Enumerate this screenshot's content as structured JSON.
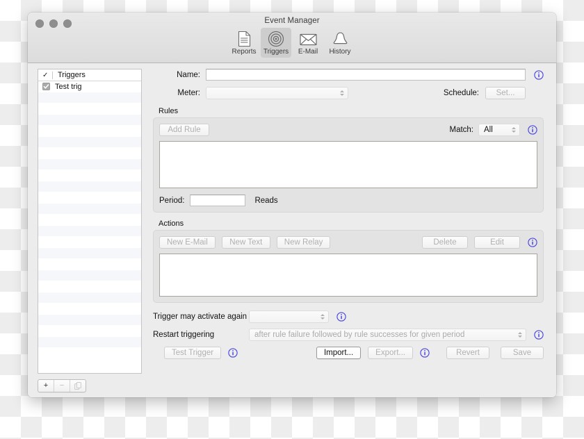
{
  "window": {
    "title": "Event Manager",
    "traffic_lights": [
      "close",
      "minimize",
      "zoom"
    ]
  },
  "toolbar": {
    "items": [
      {
        "label": "Reports",
        "icon": "document-icon",
        "selected": false
      },
      {
        "label": "Triggers",
        "icon": "target-icon",
        "selected": true
      },
      {
        "label": "E-Mail",
        "icon": "envelope-icon",
        "selected": false
      },
      {
        "label": "History",
        "icon": "bell-icon",
        "selected": false
      }
    ]
  },
  "sidebar": {
    "header": {
      "check": "✓",
      "label": "Triggers"
    },
    "rows": [
      {
        "label": "Test trig",
        "checked": true
      }
    ],
    "footer": {
      "add_label": "+",
      "remove_label": "−",
      "duplicate_label": "duplicate-icon"
    }
  },
  "main": {
    "name": {
      "label": "Name:",
      "value": "",
      "placeholder": ""
    },
    "meter": {
      "label": "Meter:",
      "value": "",
      "enabled": false
    },
    "schedule": {
      "label": "Schedule:",
      "button_label": "Set...",
      "enabled": false
    },
    "rules": {
      "group_label": "Rules",
      "add_rule_label": "Add Rule",
      "match_label": "Match:",
      "match_value": "All",
      "rules_list": [],
      "period_label": "Period:",
      "period_value": "",
      "period_units": "Reads"
    },
    "actions": {
      "group_label": "Actions",
      "new_email_label": "New E-Mail",
      "new_text_label": "New Text",
      "new_relay_label": "New Relay",
      "delete_label": "Delete",
      "edit_label": "Edit",
      "actions_list": []
    },
    "reactivate": {
      "label": "Trigger may activate again",
      "value": ""
    },
    "restart": {
      "label": "Restart triggering",
      "value": "after rule failure followed by rule successes for given period"
    }
  },
  "footer": {
    "test_trigger_label": "Test Trigger",
    "import_label": "Import...",
    "export_label": "Export...",
    "revert_label": "Revert",
    "save_label": "Save"
  },
  "colors": {
    "info_blue": "#4a45e0",
    "window_chrome": "#ececec",
    "group_bg": "#e3e3e3",
    "list_border": "#a9a499",
    "selected_toolbar": "#cdcdcd"
  }
}
